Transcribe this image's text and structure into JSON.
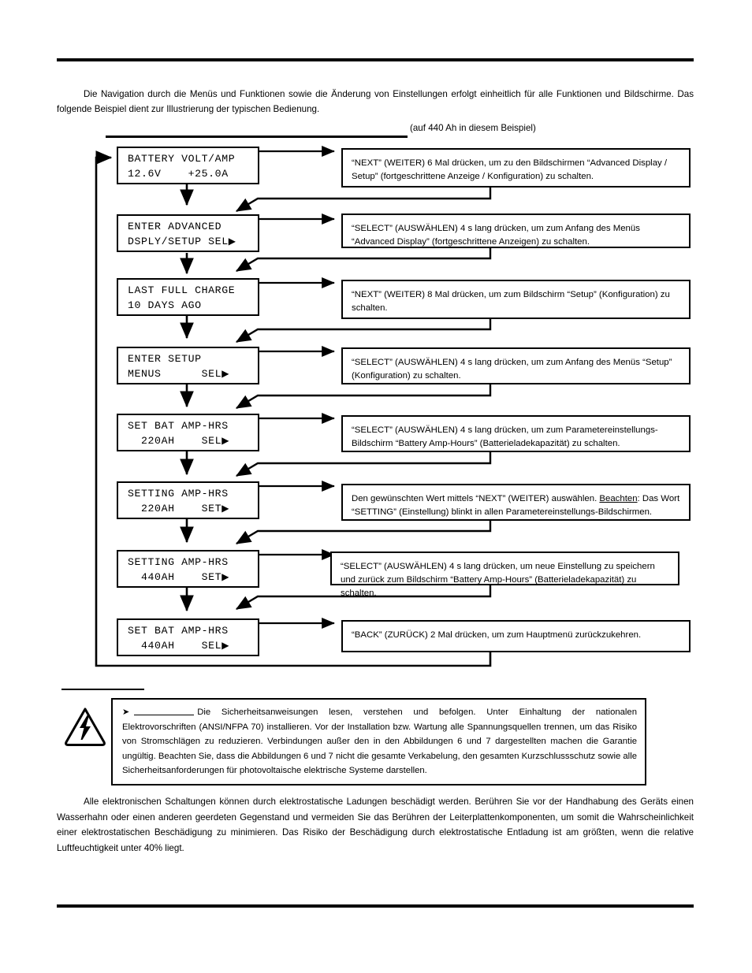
{
  "page": {
    "intro_paragraph": "Die Navigation durch die Menüs und Funktionen sowie die Änderung von Einstellungen erfolgt einheitlich für alle Funktionen und Bildschirme. Das folgende Beispiel dient zur Illustrierung der typischen Bedienung.",
    "caption_note": "(auf 440 Ah in diesem Beispiel)",
    "esd_paragraph": "Alle elektronischen Schaltungen können durch elektrostatische Ladungen beschädigt werden. Berühren Sie vor der Handhabung des Geräts einen Wasserhahn oder einen anderen geerdeten Gegenstand und vermeiden Sie das Berühren der Leiterplattenkomponenten, um somit die Wahrscheinlichkeit einer elektrostatischen Beschädigung zu minimieren. Das Risiko der Beschädigung durch elektrostatische Entladung ist am größten, wenn die relative Luftfeuchtigkeit unter 40% liegt."
  },
  "flow": {
    "steps": [
      {
        "screen_line1": "BATTERY VOLT/AMP",
        "screen_line2": "12.6V    +25.0A",
        "screen_caret": "",
        "description": "“NEXT” (WEITER) 6 Mal drücken, um zu den Bildschirmen “Advanced Display / Setup” (fortgeschrittene Anzeige / Konfiguration) zu schalten."
      },
      {
        "screen_line1": "ENTER ADVANCED",
        "screen_line2": "DSPLY/SETUP SEL",
        "screen_caret": "▶",
        "description": "“SELECT” (AUSWÄHLEN) 4 s lang drücken, um zum Anfang des Menüs “Advanced Display” (fortgeschrittene Anzeigen) zu schalten."
      },
      {
        "screen_line1": "LAST FULL CHARGE",
        "screen_line2": "10 DAYS AGO",
        "screen_caret": "",
        "description": "“NEXT” (WEITER) 8 Mal drücken, um zum Bildschirm “Setup” (Konfiguration) zu schalten."
      },
      {
        "screen_line1": "ENTER SETUP",
        "screen_line2": "MENUS      SEL",
        "screen_caret": "▶",
        "description": "“SELECT” (AUSWÄHLEN) 4 s lang drücken, um zum Anfang des Menüs “Setup” (Konfiguration) zu schalten."
      },
      {
        "screen_line1": "SET BAT AMP-HRS",
        "screen_line2": "  220AH    SEL",
        "screen_caret": "▶",
        "description": "“SELECT” (AUSWÄHLEN) 4 s lang drücken, um zum Parametereinstellungs-Bildschirm “Battery Amp-Hours” (Batterieladekapazität) zu schalten."
      },
      {
        "screen_line1": "SETTING AMP-HRS",
        "screen_line2": "  220AH    SET",
        "screen_caret": "▶",
        "description": "Den gewünschten Wert mittels “NEXT” (WEITER) auswählen. Beachten: Das Wort “SETTING” (Einstellung) blinkt in allen Parametereinstellungs-Bildschirmen.",
        "description_underlined_word": "Beachten"
      },
      {
        "screen_line1": "SETTING AMP-HRS",
        "screen_line2": "  440AH    SET",
        "screen_caret": "▶",
        "description": "“SELECT” (AUSWÄHLEN) 4 s lang drücken, um neue Einstellung zu speichern und zurück zum Bildschirm “Battery Amp-Hours” (Batterieladekapazität) zu schalten."
      },
      {
        "screen_line1": "SET BAT AMP-HRS",
        "screen_line2": "  440AH    SEL",
        "screen_caret": "▶",
        "description": "“BACK” (ZURÜCK) 2 Mal drücken, um zum Hauptmenü zurückzukehren."
      }
    ]
  },
  "warning": {
    "icon": "electric-shock-warning-icon",
    "text_before_blank": "",
    "text": "Die Sicherheitsanweisungen lesen, verstehen und befolgen. Unter Einhaltung der nationalen Elektrovorschriften (ANSI/NFPA 70) installieren. Vor der Installation bzw. Wartung alle Spannungsquellen trennen, um das Risiko von Stromschlägen zu reduzieren. Verbindungen außer den in den Abbildungen 6 und 7 dargestellten machen die Garantie ungültig. Beachten Sie, dass die Abbildungen 6 und 7 nicht die gesamte Verkabelung, den gesamten Kurzschlussschutz sowie alle Sicherheitsanforderungen für photovoltaische elektrische Systeme darstellen."
  },
  "colors": {
    "ink": "#000000",
    "paper": "#ffffff"
  }
}
